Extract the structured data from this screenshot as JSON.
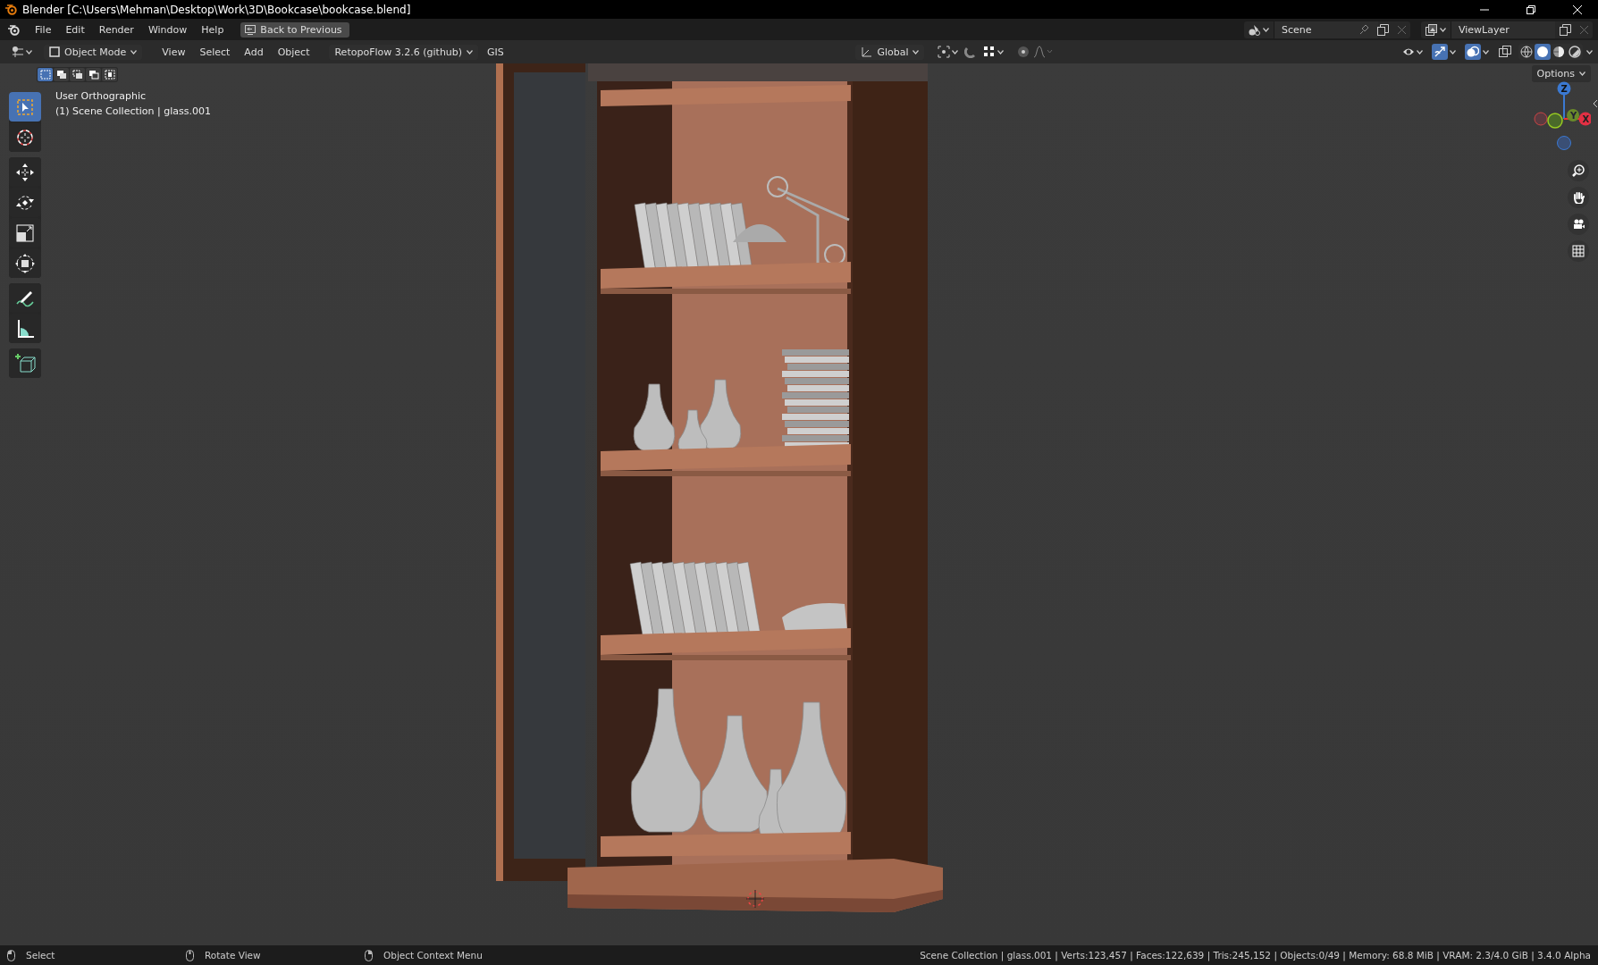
{
  "window": {
    "title": "Blender [C:\\Users\\Mehman\\Desktop\\Work\\3D\\Bookcase\\bookcase.blend]"
  },
  "menu": [
    "File",
    "Edit",
    "Render",
    "Window",
    "Help"
  ],
  "back_button": "Back to Previous",
  "scene": "Scene",
  "view_layer": "ViewLayer",
  "header": {
    "mode": "Object Mode",
    "menus": [
      "View",
      "Select",
      "Add",
      "Object"
    ],
    "addon": "RetopoFlow 3.2.6 (github)",
    "gis": "GIS",
    "orientation": "Global",
    "gizmos_on": true,
    "overlays_on": true
  },
  "shading": [
    {
      "kind": "wireframe",
      "selected": false
    },
    {
      "kind": "solid",
      "selected": true
    },
    {
      "kind": "material",
      "selected": false
    },
    {
      "kind": "rendered",
      "selected": false
    }
  ],
  "options": "Options",
  "select_modes": [
    {
      "selected": true
    },
    {
      "selected": false
    },
    {
      "selected": false
    },
    {
      "selected": false
    },
    {
      "selected": false
    }
  ],
  "tool_groups": [
    [
      {
        "kind": "select",
        "selected": true
      },
      {
        "kind": "cursor",
        "selected": false
      }
    ],
    [
      {
        "kind": "move",
        "selected": false
      },
      {
        "kind": "rotate",
        "selected": false
      },
      {
        "kind": "scale",
        "selected": false
      },
      {
        "kind": "transform",
        "selected": false
      }
    ],
    [
      {
        "kind": "annotate",
        "selected": false
      },
      {
        "kind": "measure",
        "selected": false
      }
    ],
    [
      {
        "kind": "add-cube",
        "selected": false
      }
    ]
  ],
  "viewport": {
    "view_name": "User Orthographic",
    "collection": "(1) Scene Collection | glass.001"
  },
  "gizmo": {
    "z": "Z",
    "y": "Y",
    "x": "X"
  },
  "status_bar": {
    "hints": [
      "Select",
      "Rotate View",
      "Object Context Menu"
    ],
    "stats": "Scene Collection | glass.001 | Verts:123,457 | Faces:122,639 | Tris:245,152 | Objects:0/49 | Memory: 68.8 MiB | VRAM: 2.3/4.0 GiB | 3.4.0 Alpha"
  }
}
